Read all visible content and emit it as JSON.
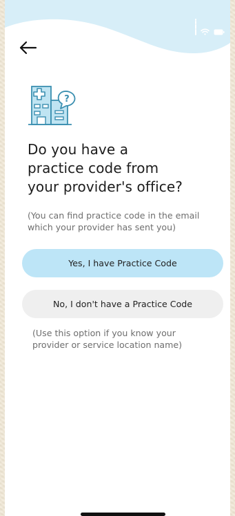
{
  "header": {
    "back_icon": "arrow-left-icon"
  },
  "illustration": {
    "icon": "hospital-question-icon",
    "stroke_color": "#3b8fb0",
    "fill_color": "#bfe4f2",
    "question_mark": "?"
  },
  "main": {
    "title_line1": "Do you have a",
    "title_line2": "practice code from",
    "title_line3": "your provider's office?",
    "subtitle_line1": "(You can find practice code in the email",
    "subtitle_line2": "which your provider has sent you)"
  },
  "options": {
    "yes_label": "Yes, I have Practice Code",
    "no_label": "No, I don't have a Practice Code",
    "hint_line1": "(Use this option if you know your",
    "hint_line2": "provider or service location name)"
  },
  "colors": {
    "primary_button": "#bde5f7",
    "secondary_button": "#efefef",
    "header_wave": "#d7eef8"
  }
}
